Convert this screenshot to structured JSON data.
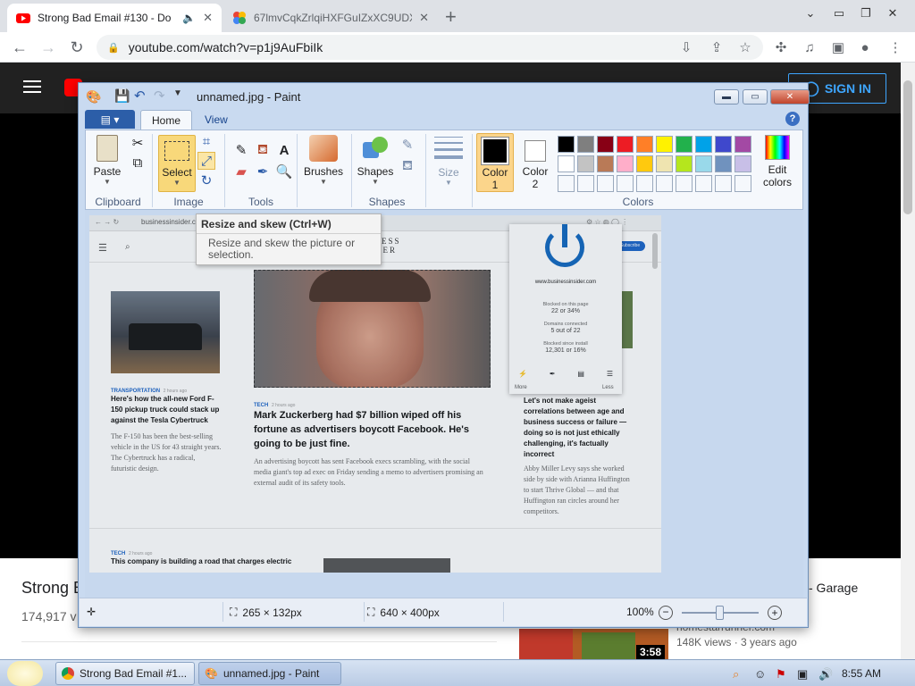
{
  "browser": {
    "tabs": [
      {
        "title": "Strong Bad Email #130 - Do",
        "active": true
      },
      {
        "title": "67lmvCqkZrlqiHXFGuIZxXC9UDX",
        "active": false
      }
    ],
    "url": "youtube.com/watch?v=p1j9AuFbiIk",
    "new_tab_symbol": "+"
  },
  "youtube": {
    "signin_label": "SIGN IN",
    "video_title": "Strong B",
    "views": "174,917 v",
    "side_title": "- Garage",
    "side_channel": "homestarrunner.com",
    "side_views": "148K views · 3 years ago",
    "duration": "3:58"
  },
  "paint": {
    "window_title": "unnamed.jpg - Paint",
    "tabs": [
      "Home",
      "View"
    ],
    "groups": {
      "clipboard": "Clipboard",
      "image": "Image",
      "tools": "Tools",
      "shapes": "Shapes",
      "colors": "Colors"
    },
    "buttons": {
      "paste": "Paste",
      "select": "Select",
      "brushes": "Brushes",
      "shapes": "Shapes",
      "size": "Size",
      "color1": "Color 1",
      "color1_a": "Color",
      "color1_b": "1",
      "color2_a": "Color",
      "color2_b": "2",
      "edit_colors_a": "Edit",
      "edit_colors_b": "colors"
    },
    "palette_row1": [
      "#000000",
      "#7f7f7f",
      "#880015",
      "#ed1c24",
      "#ff7f27",
      "#fff200",
      "#22b14c",
      "#00a2e8",
      "#3f48cc",
      "#a349a4"
    ],
    "palette_row2": [
      "#ffffff",
      "#c3c3c3",
      "#b97a57",
      "#ffaec9",
      "#ffc90e",
      "#efe4b0",
      "#b5e61d",
      "#99d9ea",
      "#7092be",
      "#c8bfe7"
    ],
    "tooltip": {
      "title": "Resize and skew (Ctrl+W)",
      "body": "Resize and skew the picture or selection."
    },
    "status": {
      "selection_size": "265 × 132px",
      "image_size": "640 × 400px",
      "zoom": "100%"
    }
  },
  "canvas_page": {
    "url": "businessinsider.com",
    "logo_a": "BUSINESS",
    "logo_b": "INSIDER",
    "subscribe": "Subscribe",
    "left_article": {
      "tag": "TRANSPORTATION",
      "time": "2 hours ago",
      "headline": "Here's how the all-new Ford F-150 pickup truck could stack up against the Tesla Cybertruck",
      "body": "The F-150 has been the best-selling vehicle in the US for 43 straight years. The Cybertruck has a radical, futuristic design."
    },
    "center_article": {
      "tag": "TECH",
      "time": "2 hours ago",
      "headline": "Mark Zuckerberg had $7 billion wiped off his fortune as advertisers boycott Facebook. He's going to be just fine.",
      "body": "An advertising boycott has sent Facebook execs scrambling, with the social media giant's top ad exec on Friday sending a memo to advertisers promising an external audit of its safety tools."
    },
    "right_article": {
      "headline": "Let's not make ageist correlations between age and business success or failure — doing so is not just ethically challenging, it's factually incorrect",
      "body": "Abby Miller Levy says she worked side by side with Arianna Huffington to start Thrive Global — and that Huffington ran circles around her competitors."
    },
    "bottom_article": {
      "tag": "TECH",
      "time": "2 hours ago",
      "headline": "This company is building a road that charges electric"
    },
    "blocker_popup": {
      "domain": "www.businessinsider.com",
      "blocked_label": "Blocked on this page",
      "blocked_value": "22 or 34%",
      "domains_label": "Domains connected",
      "domains_value": "5 out of 22",
      "since_label": "Blocked since install",
      "since_value": "12,301 or 16%",
      "more": "More",
      "less": "Less"
    }
  },
  "taskbar": {
    "tasks": [
      {
        "label": "Strong Bad Email #1...",
        "active": false
      },
      {
        "label": "unnamed.jpg - Paint",
        "active": true
      }
    ],
    "clock": "8:55 AM"
  }
}
